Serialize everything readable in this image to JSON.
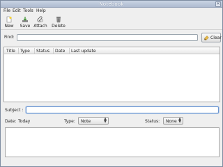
{
  "window": {
    "title": "Notebook"
  },
  "menu": {
    "file": "File",
    "edit": "Edit",
    "tools": "Tools",
    "help": "Help"
  },
  "toolbar": {
    "new": "New",
    "save": "Save",
    "attach": "Attach",
    "delete": "Delete"
  },
  "find": {
    "label": "Find:",
    "value": "",
    "clear_label": "Clear"
  },
  "table": {
    "columns": [
      "Title",
      "Type",
      "Status",
      "Date",
      "Last update"
    ],
    "rows": []
  },
  "subject": {
    "label": "Subject :",
    "value": ""
  },
  "meta": {
    "date_label": "Date:",
    "date_value": "Today",
    "type_label": "Type:",
    "type_value": "Note",
    "status_label": "Status:",
    "status_value": "None"
  },
  "notes": {
    "value": ""
  },
  "icons": {
    "new": "new-document-icon",
    "save": "save-icon",
    "attach": "attach-icon",
    "delete": "trash-icon",
    "clear": "brush-icon",
    "close": "close-icon"
  },
  "colors": {
    "titlebar": "#aebbd0",
    "focus": "#6b95cf"
  }
}
